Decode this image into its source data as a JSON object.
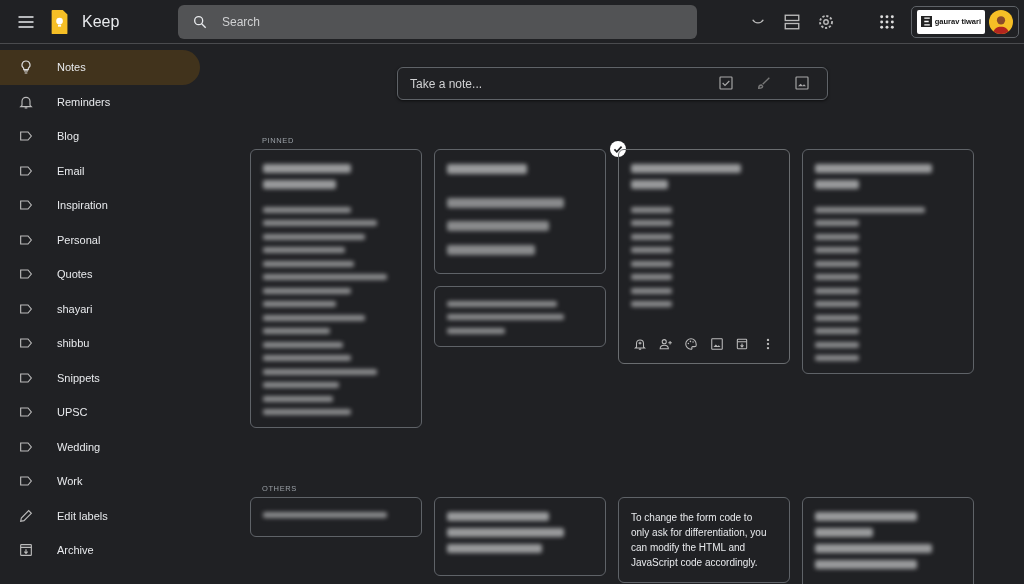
{
  "header": {
    "app_name": "Keep",
    "search": {
      "placeholder": "Search"
    },
    "account": {
      "brand": "gaurav tiwari"
    }
  },
  "sidebar": {
    "items": [
      {
        "label": "Notes",
        "kind": "notes",
        "selected": true
      },
      {
        "label": "Reminders",
        "kind": "reminders",
        "selected": false
      },
      {
        "label": "Blog",
        "kind": "label",
        "selected": false
      },
      {
        "label": "Email",
        "kind": "label",
        "selected": false
      },
      {
        "label": "Inspiration",
        "kind": "label",
        "selected": false
      },
      {
        "label": "Personal",
        "kind": "label",
        "selected": false
      },
      {
        "label": "Quotes",
        "kind": "label",
        "selected": false
      },
      {
        "label": "shayari",
        "kind": "label",
        "selected": false
      },
      {
        "label": "shibbu",
        "kind": "label",
        "selected": false
      },
      {
        "label": "Snippets",
        "kind": "label",
        "selected": false
      },
      {
        "label": "UPSC",
        "kind": "label",
        "selected": false
      },
      {
        "label": "Wedding",
        "kind": "label",
        "selected": false
      },
      {
        "label": "Work",
        "kind": "label",
        "selected": false
      },
      {
        "label": "Edit labels",
        "kind": "edit",
        "selected": false
      },
      {
        "label": "Archive",
        "kind": "archive",
        "selected": false
      }
    ]
  },
  "take_note": {
    "placeholder": "Take a note..."
  },
  "pinned": {
    "label": "PINNED",
    "columns": [
      {
        "notes": [
          {
            "kind": "blurred",
            "selected": false
          }
        ]
      },
      {
        "notes": [
          {
            "kind": "blurred",
            "selected": false
          },
          {
            "kind": "blurred",
            "selected": false
          }
        ]
      },
      {
        "notes": [
          {
            "kind": "blurred",
            "selected": true
          }
        ]
      },
      {
        "notes": [
          {
            "kind": "blurred",
            "selected": false
          }
        ]
      }
    ]
  },
  "others": {
    "label": "OTHERS",
    "columns": [
      {
        "notes": [
          {
            "kind": "blurred",
            "selected": false
          }
        ]
      },
      {
        "notes": [
          {
            "kind": "blurred",
            "selected": false
          }
        ]
      },
      {
        "notes": [
          {
            "kind": "text",
            "selected": false,
            "text": "To change the form code to only ask for differentiation, you can modify the HTML and JavaScript code accordingly."
          }
        ]
      },
      {
        "notes": [
          {
            "kind": "blurred",
            "selected": false
          }
        ]
      }
    ]
  }
}
